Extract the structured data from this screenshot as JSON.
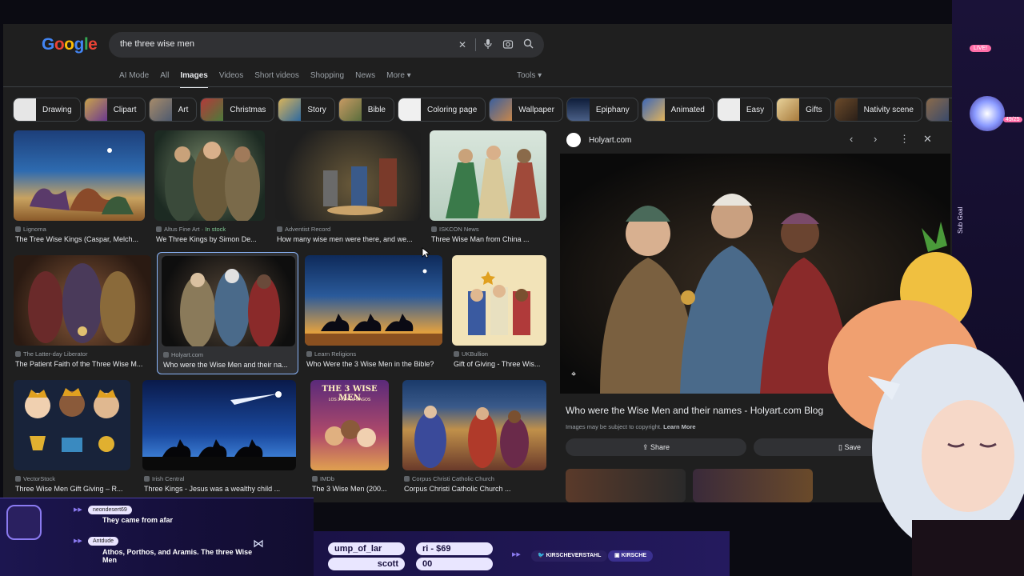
{
  "search": {
    "query": "the three wise men",
    "clear_icon": "close-icon",
    "mic_icon": "mic-icon",
    "lens_icon": "camera-icon",
    "search_icon": "search-icon"
  },
  "logo": [
    "G",
    "o",
    "o",
    "g",
    "l",
    "e"
  ],
  "nav": {
    "items": [
      "AI Mode",
      "All",
      "Images",
      "Videos",
      "Short videos",
      "Shopping",
      "News",
      "More ▾"
    ],
    "active": "Images",
    "tools": "Tools ▾"
  },
  "chips": [
    "Drawing",
    "Clipart",
    "Art",
    "Christmas",
    "Story",
    "Bible",
    "Coloring page",
    "Wallpaper",
    "Epiphany",
    "Animated",
    "Easy",
    "Gifts",
    "Nativity scene",
    "M"
  ],
  "results": [
    {
      "source": "Lignoma",
      "title": "The Tree Wise Kings (Caspar, Melch..."
    },
    {
      "source": "Altus Fine Art",
      "stock": " · In stock",
      "title": "We Three Kings by Simon De..."
    },
    {
      "source": "Adventist Record",
      "title": "How many wise men were there, and we..."
    },
    {
      "source": "ISKCON News",
      "title": "Three Wise Man from China ..."
    },
    {
      "source": "The Latter-day Liberator",
      "title": "The Patient Faith of the Three Wise M..."
    },
    {
      "source": "Holyart.com",
      "title": "Who were the Wise Men and their na..."
    },
    {
      "source": "Learn Religions",
      "title": "Who Were the 3 Wise Men in the Bible?"
    },
    {
      "source": "UKBullion",
      "title": "Gift of Giving - Three Wis..."
    },
    {
      "source": "VectorStock",
      "title": "Three Wise Men Gift Giving – R..."
    },
    {
      "source": "Irish Central",
      "title": "Three Kings - Jesus was a wealthy child ..."
    },
    {
      "source": "IMDb",
      "title": "The 3 Wise Men (200..."
    },
    {
      "source": "Corpus Christi Catholic Church",
      "title": "Corpus Christi Catholic Church ..."
    }
  ],
  "movie_poster": {
    "line1": "THE 3 WISE MEN",
    "line2": "LOS 3 REYES MAGOS"
  },
  "panel": {
    "site": "Holyart.com",
    "title": "Who were the Wise Men and their names - Holyart.com Blog",
    "note": "Images may be subject to copyright.",
    "learn_more": "Learn More",
    "share": "Share",
    "save": "Save"
  },
  "overlay": {
    "chat": [
      {
        "user": "neondesert69",
        "message": "They came from afar"
      },
      {
        "user": "Antdude",
        "message": "Athos, Porthos, and Aramis. The three Wise Men"
      }
    ],
    "pills": [
      "ump_of_lar",
      "ri - $69",
      "scott",
      "00"
    ],
    "handles": [
      "KIRSCHEVERSTAHL",
      "KIRSCHE"
    ],
    "live": "LIVE!",
    "sub_goal": "Sub Goal",
    "sub_count": "49/25"
  }
}
